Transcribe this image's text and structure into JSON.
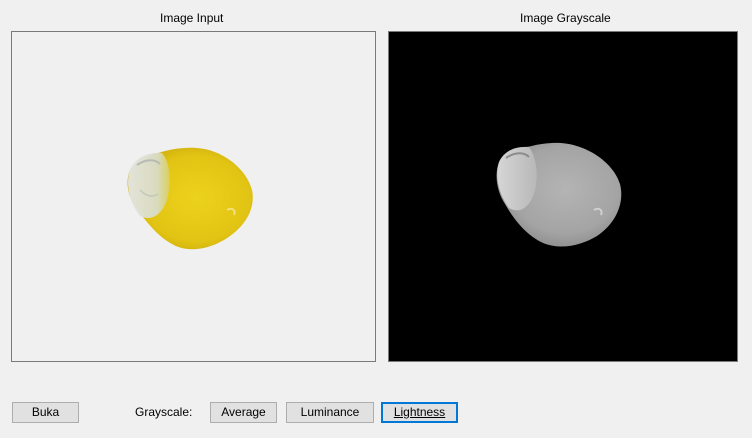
{
  "panels": {
    "input_title": "Image Input",
    "grayscale_title": "Image Grayscale"
  },
  "controls": {
    "open_button": "Buka",
    "grayscale_label": "Grayscale:",
    "average_button": "Average",
    "luminance_button": "Luminance",
    "lightness_button": "Lightness",
    "focused_button": "lightness"
  },
  "colors": {
    "window_bg": "#f0f0f0",
    "grayscale_bg": "#000000",
    "focus_border": "#0078d7",
    "kernel_yellow": "#e8cc1a"
  }
}
